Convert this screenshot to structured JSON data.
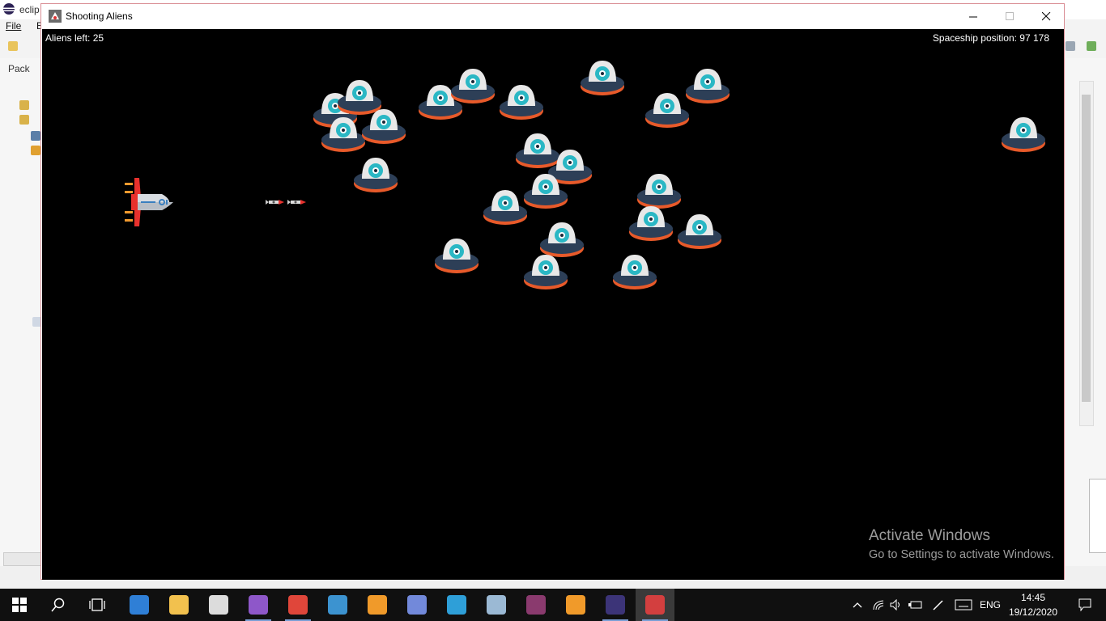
{
  "eclipse": {
    "title": "eclip",
    "menu_file": "File",
    "menu_edit": "E",
    "package_label": "Pack"
  },
  "window": {
    "title": "Shooting Aliens",
    "minimize": "Minimize",
    "maximize": "Maximize",
    "close": "Close"
  },
  "game": {
    "aliens_left": "Aliens left: 25",
    "ship_position": "Spaceship position: 97 178"
  },
  "watermark": {
    "title": "Activate Windows",
    "subtitle": "Go to Settings to activate Windows."
  },
  "taskbar": {
    "apps": [
      "edge-icon",
      "file-explorer-icon",
      "store-icon",
      "app-purple-icon",
      "chrome-icon",
      "app-globe-icon",
      "media-player-icon",
      "app-discord-icon",
      "eclipse-e-icon",
      "photo-icon",
      "winrar-icon",
      "sublime-icon",
      "eclipse-icon",
      "java-app-icon"
    ],
    "language": "ENG",
    "time": "14:45",
    "date": "19/12/2020"
  },
  "colors": {
    "canvas": "#000000",
    "alien_dome": "#e8e8e8",
    "alien_eye": "#2ab7c4",
    "alien_body": "#2d3f57",
    "alien_rim": "#e85a2a",
    "ship_red": "#e8312d",
    "taskbar": "#101010"
  }
}
